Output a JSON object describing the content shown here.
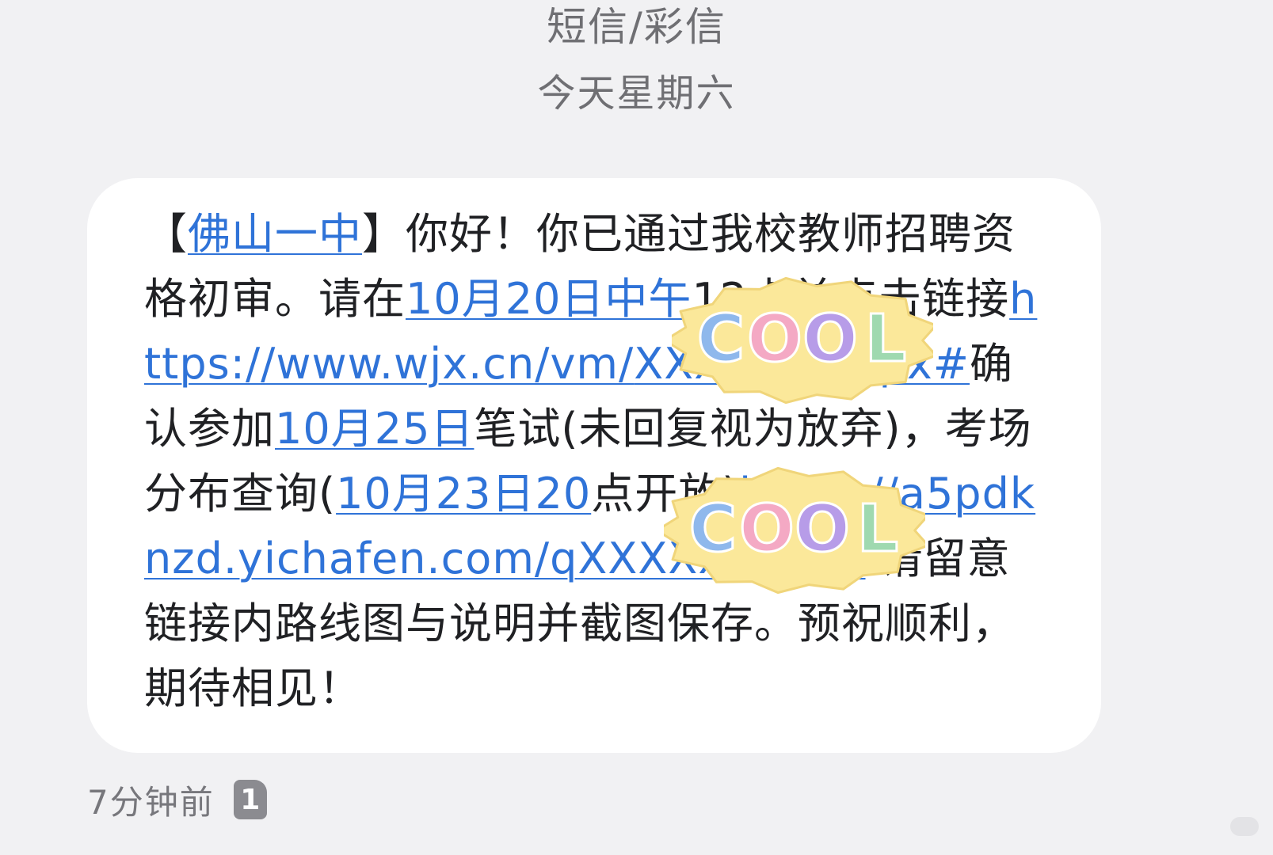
{
  "header": {
    "message_type": "短信/彩信",
    "date": "今天星期六"
  },
  "message": {
    "segments": [
      {
        "text": "【",
        "link": false
      },
      {
        "text": "佛山一中",
        "link": true
      },
      {
        "text": "】你好！你已通过我校教师招聘资格初审。请在",
        "link": false
      },
      {
        "text": "10月20日中午",
        "link": true
      },
      {
        "text": "12点前点击链接",
        "link": false
      },
      {
        "text": "https://www.wjx.cn/vm/",
        "link": true
      },
      {
        "text": "XXXXXX.aspx#",
        "link": true
      },
      {
        "text": "确认参加",
        "link": false
      },
      {
        "text": "10月25日",
        "link": true
      },
      {
        "text": "笔试(未回复视为放弃)，考场分布查询(",
        "link": false
      },
      {
        "text": "10月23日20",
        "link": true
      },
      {
        "text": "点开放)",
        "link": false
      },
      {
        "text": "https://a5pdknzd.yichafen.com/q",
        "link": true
      },
      {
        "text": "XXXXXXXXAt",
        "link": true
      },
      {
        "text": " 请留意链接内路线图与说明并截图保存。预祝顺利，期待相见！",
        "link": false
      }
    ]
  },
  "stickers": [
    {
      "label": "COOL",
      "letter_colors": [
        "#8fb8ec",
        "#f4a9c4",
        "#b79ce8",
        "#9fd9b0"
      ],
      "bg": "#fbe89a"
    },
    {
      "label": "COOL",
      "letter_colors": [
        "#8fb8ec",
        "#f4a9c4",
        "#b79ce8",
        "#9fd9b0"
      ],
      "bg": "#fbe89a"
    }
  ],
  "footer": {
    "time": "7分钟前",
    "sim": "1"
  },
  "colors": {
    "link": "#2f73d8",
    "text": "#202124",
    "meta": "#6f6f73",
    "background": "#f1f1f3"
  }
}
